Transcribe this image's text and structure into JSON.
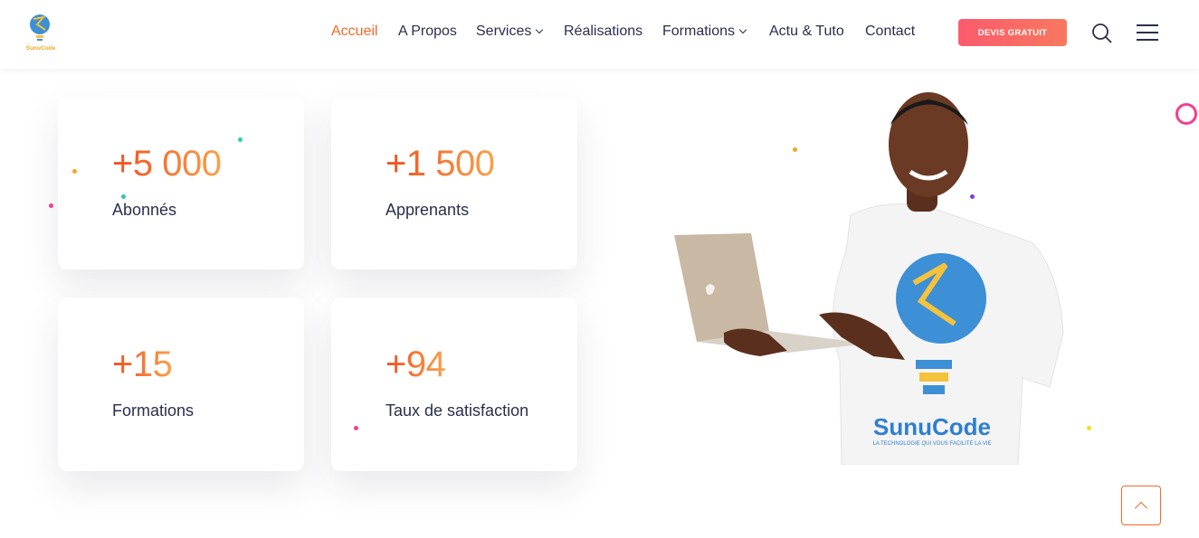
{
  "brand": {
    "logo_text": "SunuCode"
  },
  "nav": {
    "items": [
      {
        "label": "Accueil",
        "active": true,
        "dropdown": false
      },
      {
        "label": "A Propos",
        "active": false,
        "dropdown": false
      },
      {
        "label": "Services",
        "active": false,
        "dropdown": true
      },
      {
        "label": "Réalisations",
        "active": false,
        "dropdown": false
      },
      {
        "label": "Formations",
        "active": false,
        "dropdown": true
      },
      {
        "label": "Actu & Tuto",
        "active": false,
        "dropdown": false
      },
      {
        "label": "Contact",
        "active": false,
        "dropdown": false
      }
    ],
    "cta_label": "DEVIS GRATUIT"
  },
  "stats": [
    {
      "value": "+5 000",
      "label": "Abonnés"
    },
    {
      "value": "+1 500",
      "label": "Apprenants"
    },
    {
      "value": "+15",
      "label": "Formations"
    },
    {
      "value": "+94",
      "label": "Taux de satisfaction"
    }
  ],
  "hero_image": {
    "shirt_brand": "SunuCode",
    "shirt_tagline": "LA TECHNOLOGIE QUI VOUS FACILITE LA VIE"
  },
  "colors": {
    "accent": "#f26a2a",
    "cta_start": "#fb5b6d",
    "cta_end": "#f8785f",
    "text": "#2b2f4c",
    "ring": "#f53e8e"
  },
  "icons": {
    "search": "search-icon",
    "menu": "hamburger-menu-icon",
    "back_to_top": "chevron-up-icon"
  }
}
